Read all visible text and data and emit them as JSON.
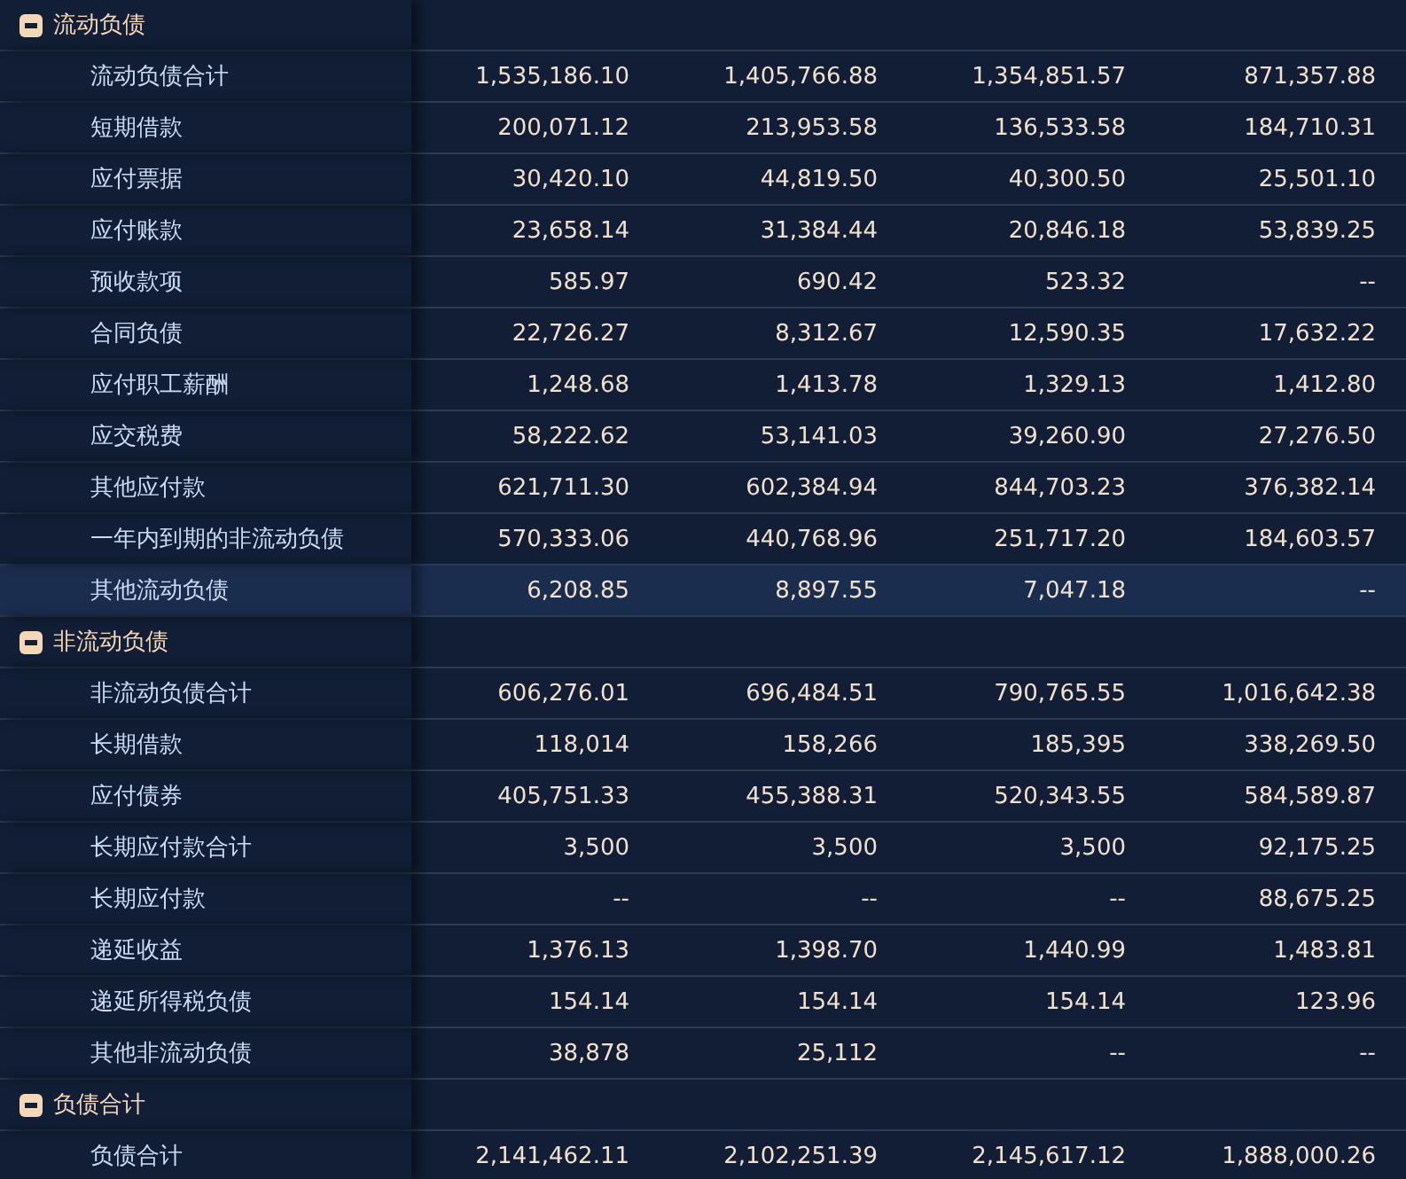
{
  "sections": [
    {
      "title": "流动负债",
      "expanded": true,
      "rows": [
        {
          "label": "流动负债合计",
          "values": [
            "1,535,186.10",
            "1,405,766.88",
            "1,354,851.57",
            "871,357.88"
          ],
          "selected": false
        },
        {
          "label": "短期借款",
          "values": [
            "200,071.12",
            "213,953.58",
            "136,533.58",
            "184,710.31"
          ],
          "selected": false
        },
        {
          "label": "应付票据",
          "values": [
            "30,420.10",
            "44,819.50",
            "40,300.50",
            "25,501.10"
          ],
          "selected": false
        },
        {
          "label": "应付账款",
          "values": [
            "23,658.14",
            "31,384.44",
            "20,846.18",
            "53,839.25"
          ],
          "selected": false
        },
        {
          "label": "预收款项",
          "values": [
            "585.97",
            "690.42",
            "523.32",
            "--"
          ],
          "selected": false
        },
        {
          "label": "合同负债",
          "values": [
            "22,726.27",
            "8,312.67",
            "12,590.35",
            "17,632.22"
          ],
          "selected": false
        },
        {
          "label": "应付职工薪酬",
          "values": [
            "1,248.68",
            "1,413.78",
            "1,329.13",
            "1,412.80"
          ],
          "selected": false
        },
        {
          "label": "应交税费",
          "values": [
            "58,222.62",
            "53,141.03",
            "39,260.90",
            "27,276.50"
          ],
          "selected": false
        },
        {
          "label": "其他应付款",
          "values": [
            "621,711.30",
            "602,384.94",
            "844,703.23",
            "376,382.14"
          ],
          "selected": false
        },
        {
          "label": "一年内到期的非流动负债",
          "values": [
            "570,333.06",
            "440,768.96",
            "251,717.20",
            "184,603.57"
          ],
          "selected": false
        },
        {
          "label": "其他流动负债",
          "values": [
            "6,208.85",
            "8,897.55",
            "7,047.18",
            "--"
          ],
          "selected": true
        }
      ]
    },
    {
      "title": "非流动负债",
      "expanded": true,
      "rows": [
        {
          "label": "非流动负债合计",
          "values": [
            "606,276.01",
            "696,484.51",
            "790,765.55",
            "1,016,642.38"
          ],
          "selected": false
        },
        {
          "label": "长期借款",
          "values": [
            "118,014",
            "158,266",
            "185,395",
            "338,269.50"
          ],
          "selected": false
        },
        {
          "label": "应付债券",
          "values": [
            "405,751.33",
            "455,388.31",
            "520,343.55",
            "584,589.87"
          ],
          "selected": false
        },
        {
          "label": "长期应付款合计",
          "values": [
            "3,500",
            "3,500",
            "3,500",
            "92,175.25"
          ],
          "selected": false
        },
        {
          "label": "长期应付款",
          "values": [
            "--",
            "--",
            "--",
            "88,675.25"
          ],
          "selected": false
        },
        {
          "label": "递延收益",
          "values": [
            "1,376.13",
            "1,398.70",
            "1,440.99",
            "1,483.81"
          ],
          "selected": false
        },
        {
          "label": "递延所得税负债",
          "values": [
            "154.14",
            "154.14",
            "154.14",
            "123.96"
          ],
          "selected": false
        },
        {
          "label": "其他非流动负债",
          "values": [
            "38,878",
            "25,112",
            "--",
            "--"
          ],
          "selected": false
        }
      ]
    },
    {
      "title": "负债合计",
      "expanded": true,
      "rows": [
        {
          "label": "负债合计",
          "values": [
            "2,141,462.11",
            "2,102,251.39",
            "2,145,617.12",
            "1,888,000.26"
          ],
          "selected": false
        }
      ]
    }
  ]
}
